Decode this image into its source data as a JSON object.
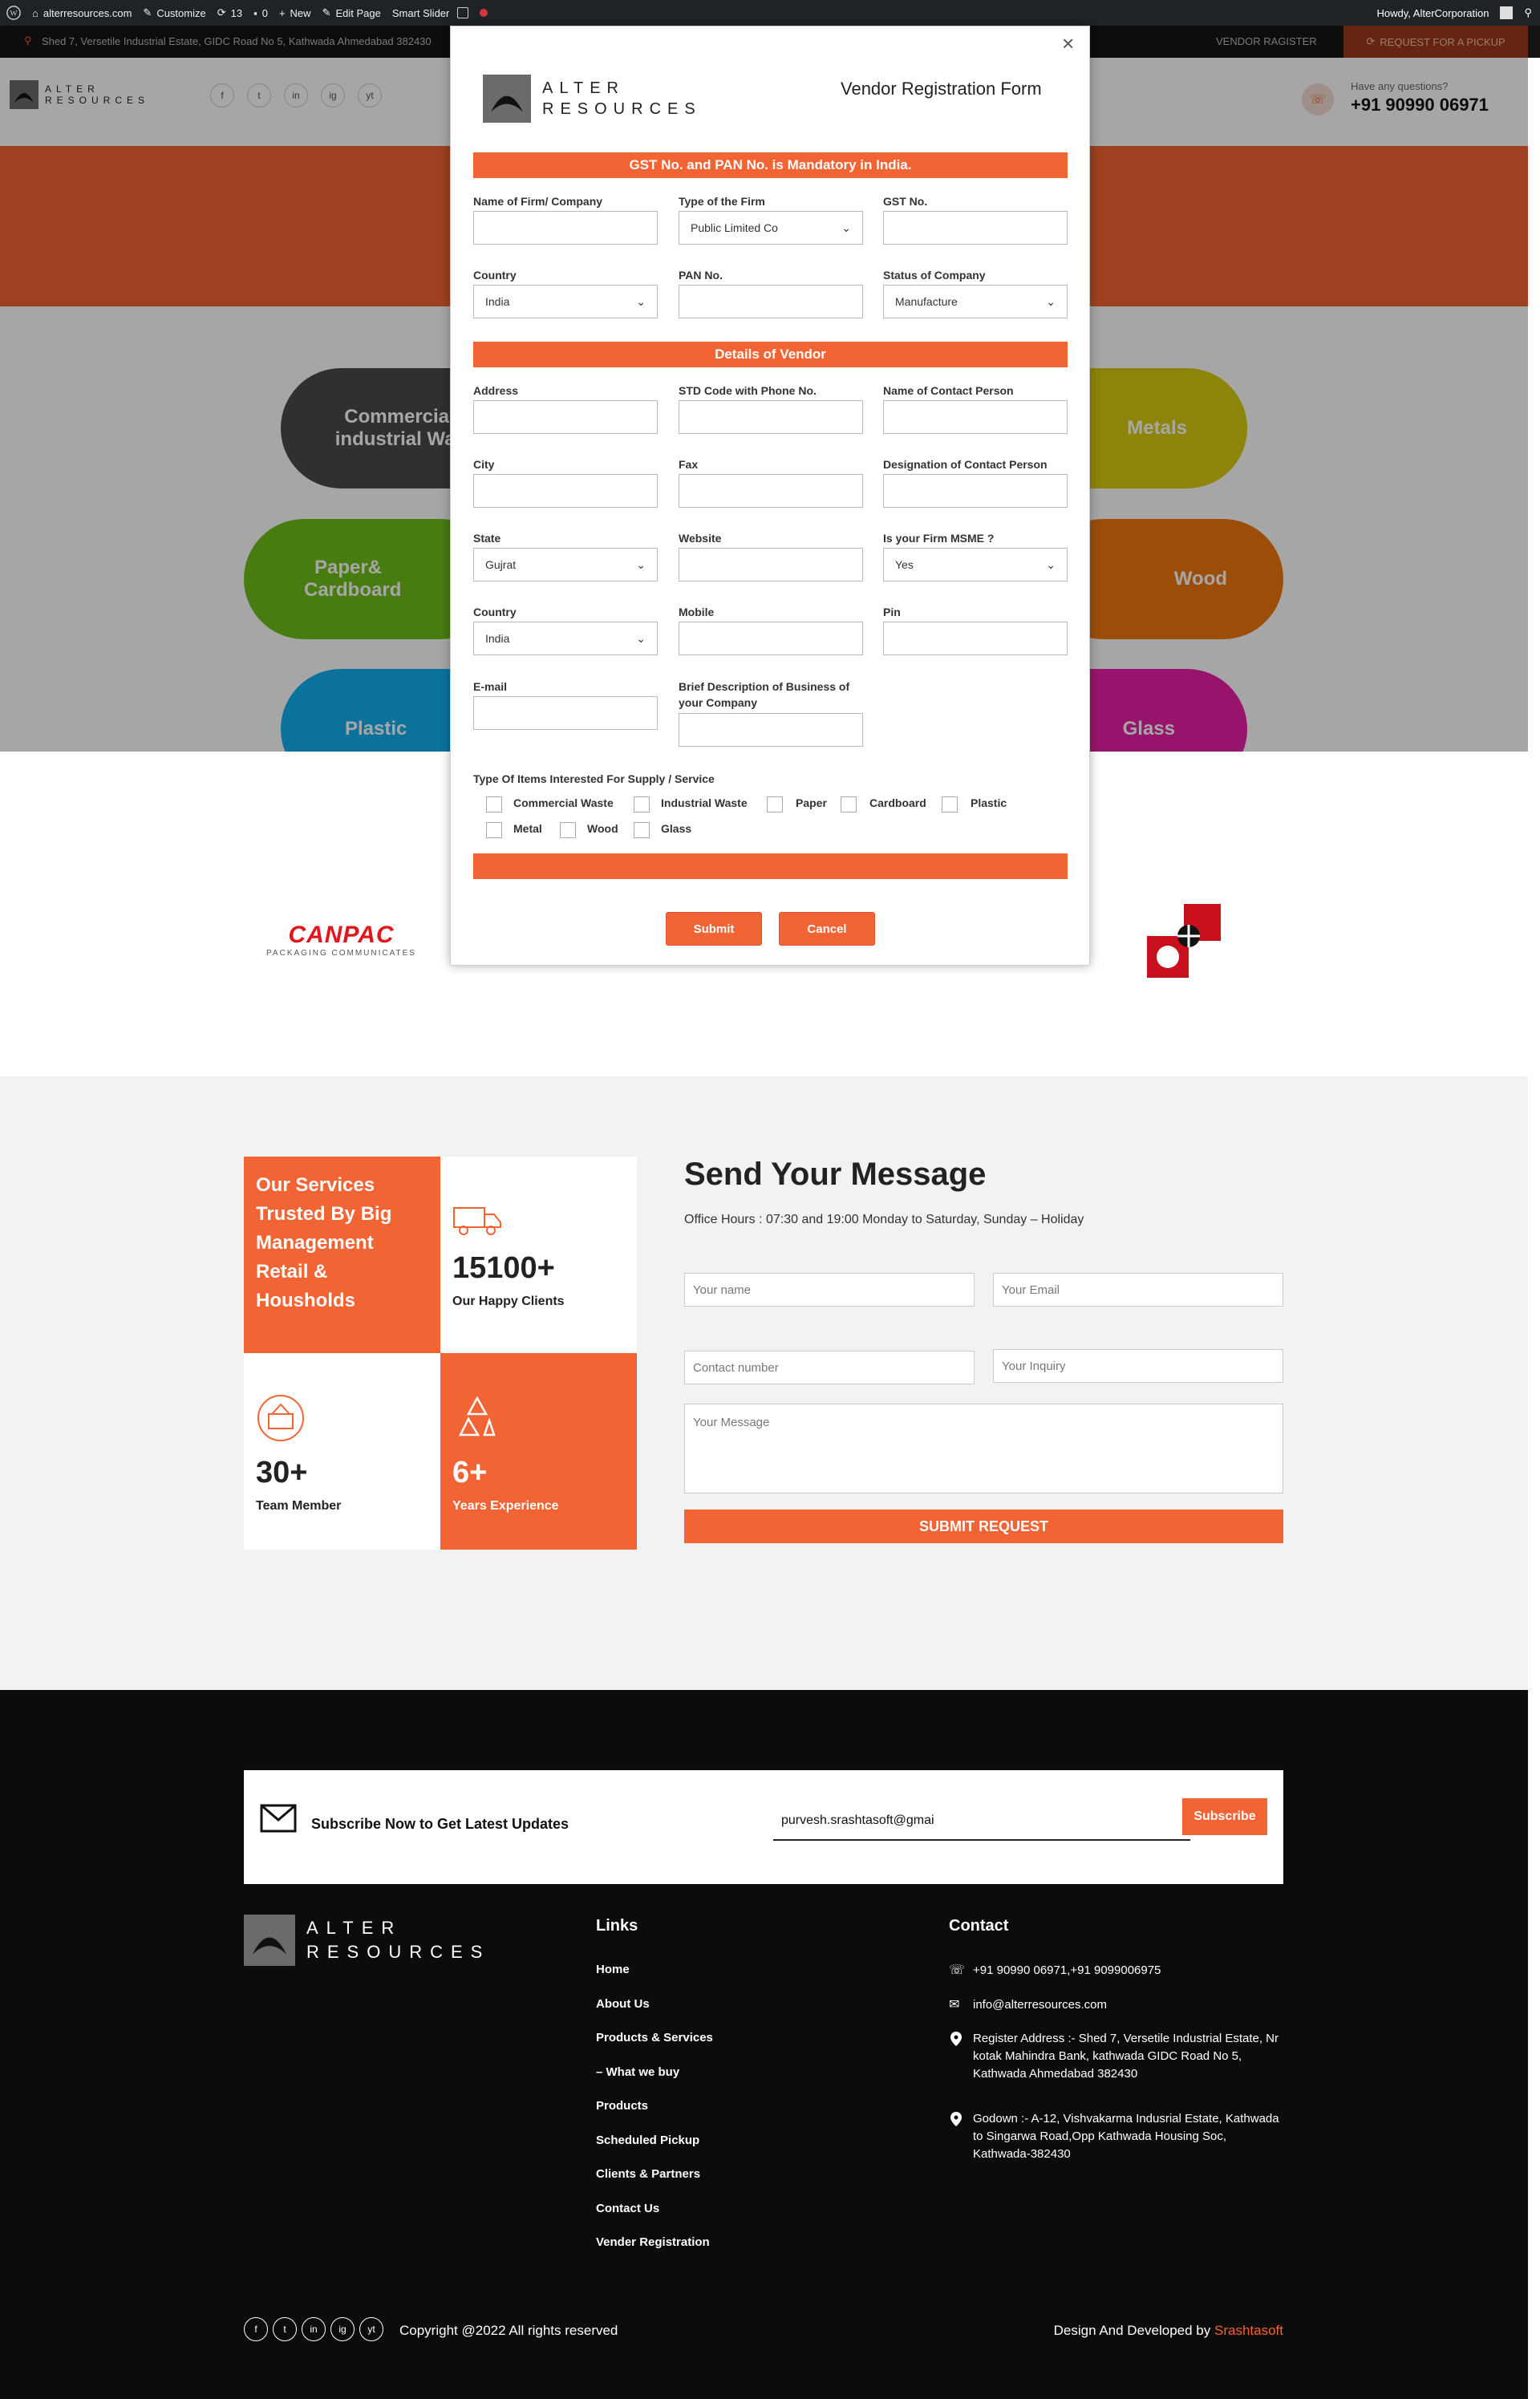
{
  "admin_bar": {
    "site": "alterresources.com",
    "customize": "Customize",
    "updates": "13",
    "comments": "0",
    "new": "New",
    "edit_page": "Edit Page",
    "smart_slider": "Smart Slider",
    "howdy": "Howdy, AlterCorporation"
  },
  "topbar": {
    "address": "Shed 7, Versetile Industrial Estate, GIDC Road No 5, Kathwada Ahmedabad 382430",
    "vendor_register": "VENDOR RAGISTER",
    "request_pickup": "REQUEST FOR A PICKUP"
  },
  "header": {
    "logo_line1": "ALTER",
    "logo_line2": "RESOURCES",
    "social": [
      "f",
      "t",
      "in",
      "ig",
      "yt"
    ],
    "question": "Have any questions?",
    "phone": "+91 90990 06971"
  },
  "categories": [
    {
      "label": "Commercial & industrial Waste",
      "color": "#4b4b4b"
    },
    {
      "label": "Metals",
      "color": "#d8cc10"
    },
    {
      "label": "Paper& Cardboard",
      "color": "#6fbf1a"
    },
    {
      "label": "Wood",
      "color": "#f0790f"
    },
    {
      "label": "Plastic",
      "color": "#11b0f0"
    },
    {
      "label": "Glass",
      "color": "#ea1fa6"
    }
  ],
  "clients": {
    "canpac": "CANPAC",
    "canpac_tag": "PACKAGING COMMUNICATES"
  },
  "modal": {
    "logo_line1": "ALTER",
    "logo_line2": "RESOURCES",
    "title": "Vendor Registration Form",
    "band_mandatory": "GST No. and PAN No. is Mandatory in India.",
    "band_details": "Details of Vendor",
    "fields": {
      "firm_name": "Name of Firm/ Company",
      "firm_type": "Type of the Firm",
      "firm_type_value": "Public Limited Co",
      "gst": "GST No.",
      "country": "Country",
      "country_value": "India",
      "pan": "PAN No.",
      "status": "Status of Company",
      "status_value": "Manufacture",
      "address": "Address",
      "std": "STD Code with Phone No.",
      "contact_person": "Name of Contact Person",
      "city": "City",
      "fax": "Fax",
      "designation": "Designation of Contact Person",
      "state": "State",
      "state_value": "Gujrat",
      "website": "Website",
      "msme": "Is your Firm MSME ?",
      "msme_value": "Yes",
      "country2": "Country",
      "country2_value": "India",
      "mobile": "Mobile",
      "pin": "Pin",
      "email": "E-mail",
      "brief": "Brief Description of Business of your Company"
    },
    "items_title": "Type Of Items Interested For Supply / Service",
    "items": [
      "Commercial Waste",
      "Industrial Waste",
      "Paper",
      "Cardboard",
      "Plastic",
      "Metal",
      "Wood",
      "Glass"
    ],
    "submit": "Submit",
    "cancel": "Cancel"
  },
  "stats": {
    "services_heading": "Our Services Trusted By Big Management Retail & Housholds",
    "clients_num": "15100+",
    "clients_label": "Our Happy Clients",
    "team_num": "30+",
    "team_label": "Team Member",
    "exp_num": "6+",
    "exp_label": "Years Experience"
  },
  "message": {
    "title": "Send Your Message",
    "hours": "Office Hours : 07:30 and 19:00 Monday to Saturday, Sunday – Holiday",
    "name_ph": "Your name",
    "email_ph": "Your Email",
    "contact_ph": "Contact number",
    "inquiry_ph": "Your Inquiry",
    "message_ph": "Your Message",
    "submit": "SUBMIT REQUEST"
  },
  "subscribe": {
    "text": "Subscribe Now to Get Latest Updates",
    "email_value": "purvesh.srashtasoft@gmai",
    "button": "Subscribe"
  },
  "footer": {
    "logo_line1": "ALTER",
    "logo_line2": "RESOURCES",
    "links_title": "Links",
    "links": [
      "Home",
      "About Us",
      "Products & Services",
      "– What we buy",
      "Products",
      "Scheduled Pickup",
      "Clients & Partners",
      "Contact Us",
      "Vender Registration"
    ],
    "contact_title": "Contact",
    "phone": "+91 90990 06971,+91 9099006975",
    "email": "info@alterresources.com",
    "register_address": "Register Address :- Shed 7, Versetile Industrial Estate, Nr kotak Mahindra Bank, kathwada GIDC Road No 5, Kathwada Ahmedabad 382430",
    "godown": "Godown :- A-12, Vishvakarma Indusrial Estate, Kathwada to Singarwa Road,Opp Kathwada Housing Soc, Kathwada-382430",
    "copyright": "Copyright @2022 All rights reserved",
    "design_by": "Design And Developed by",
    "developer": "Srashtasoft"
  },
  "colors": {
    "accent": "#f26434",
    "dark": "#0c0c0c"
  }
}
